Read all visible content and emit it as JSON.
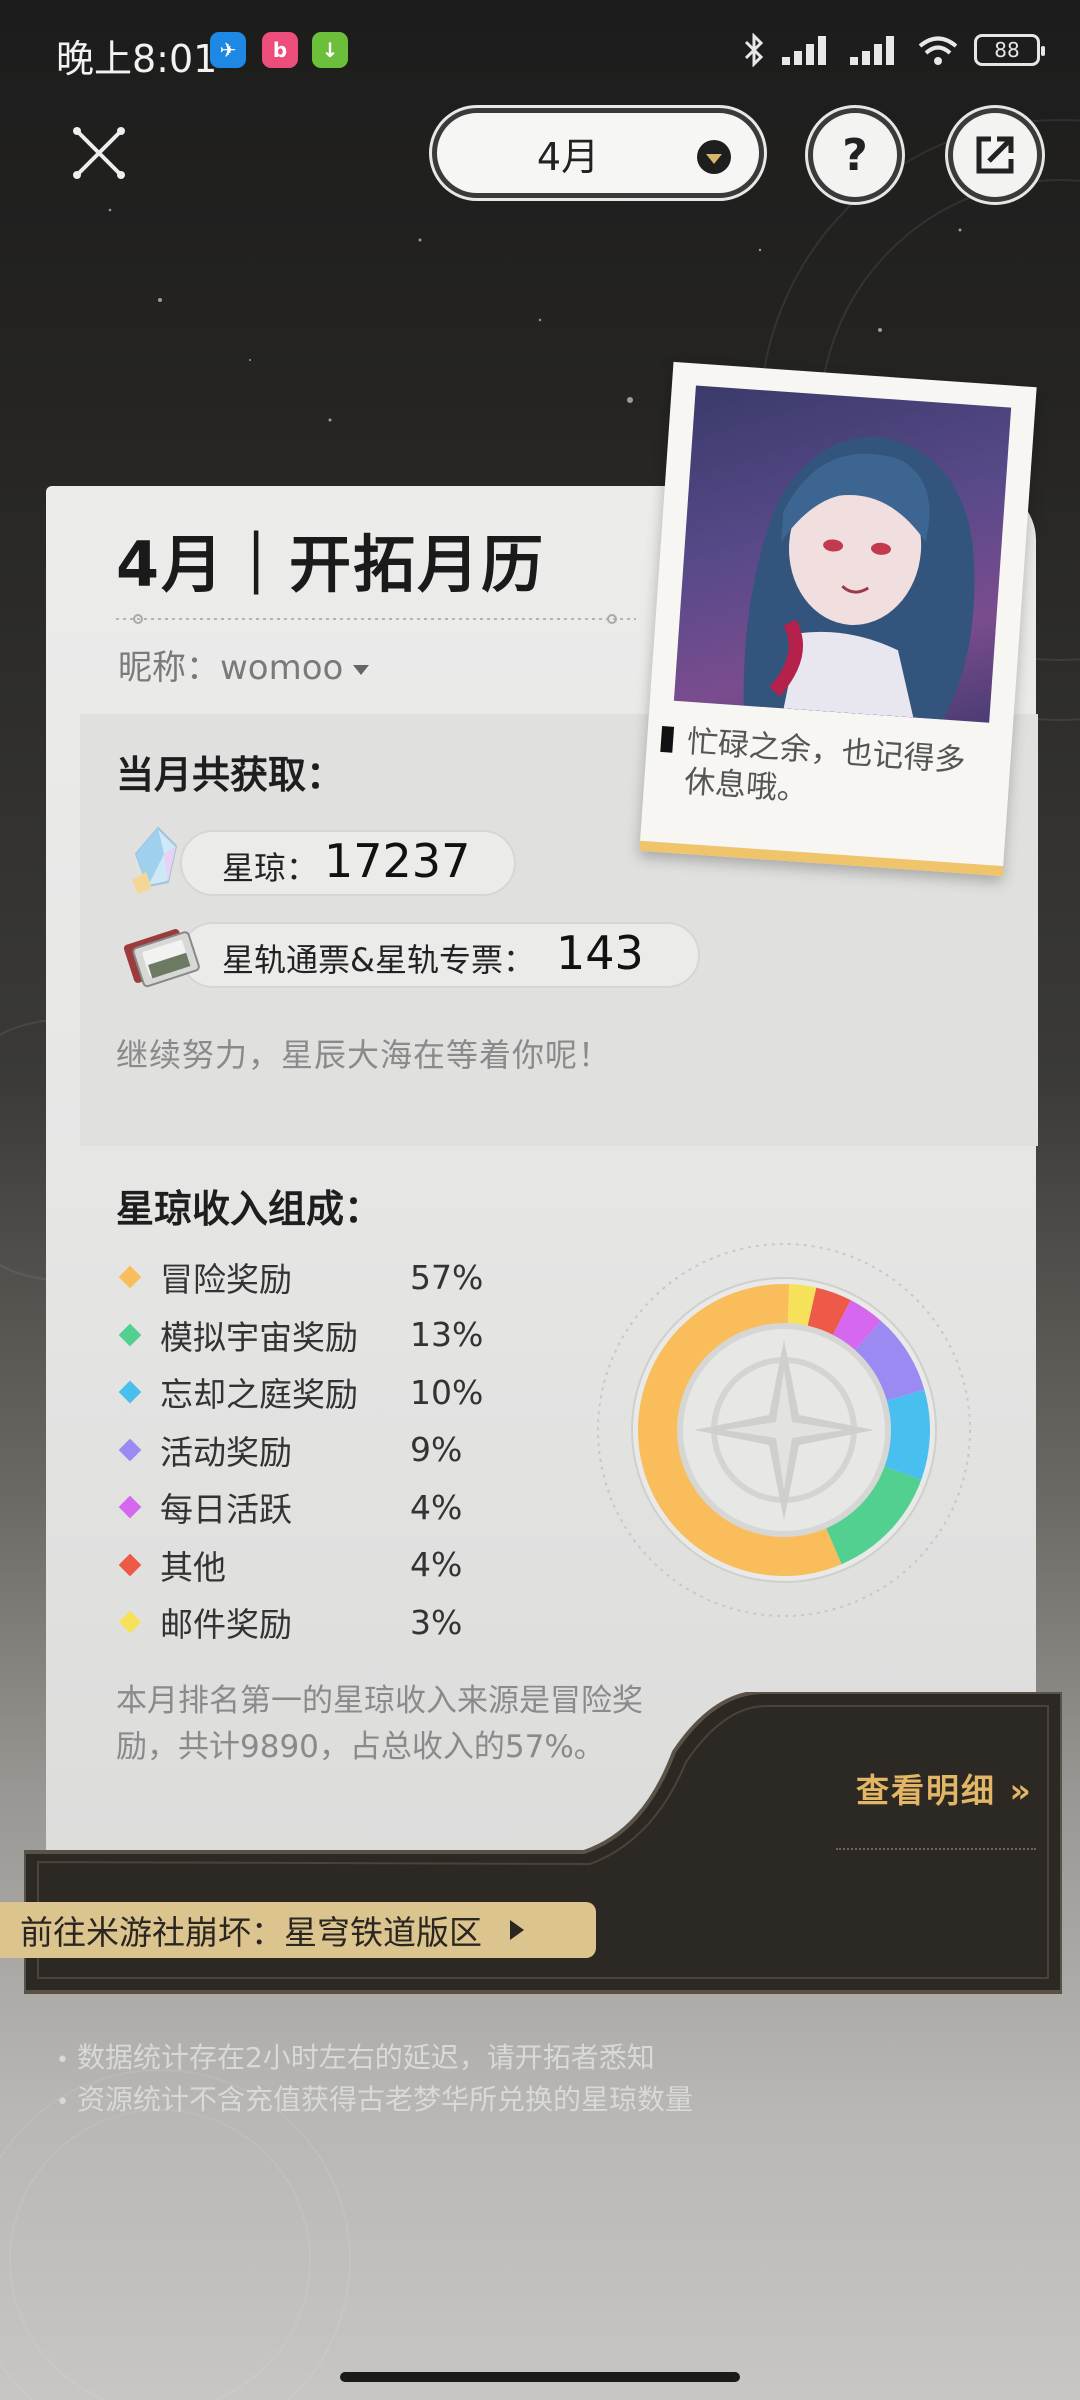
{
  "status_bar": {
    "time": "晚上8:01",
    "battery": "88",
    "apps": [
      {
        "icon": "feather-app-icon",
        "glyph": "✈",
        "color": "#1e88e5"
      },
      {
        "icon": "bilibili-app-icon",
        "glyph": "b",
        "color": "#ec4d7b"
      },
      {
        "icon": "download-app-icon",
        "glyph": "↓",
        "color": "#6bbf3a"
      }
    ]
  },
  "header": {
    "month_selector": "4月",
    "help_label": "?"
  },
  "card": {
    "title": "4月｜开拓月历",
    "nickname_label": "昵称：",
    "nickname": "womoo",
    "photo_caption": "忙碌之余，也记得多休息哦。"
  },
  "summary": {
    "heading": "当月共获取：",
    "resources": [
      {
        "label": "星琼：",
        "value": "17237",
        "icon": "stellar-jade-icon"
      },
      {
        "label": "星轨通票&星轨专票：",
        "value": "143",
        "icon": "star-rail-pass-icon"
      }
    ],
    "encouragement": "继续努力，星辰大海在等着你呢！"
  },
  "income": {
    "heading": "星琼收入组成：",
    "top_source_text": "本月排名第一的星琼收入来源是冒险奖励，共计9890，占总收入的57%。",
    "sources": [
      {
        "name": "冒险奖励",
        "percent": "57%",
        "value": 57,
        "color": "#f9bd5c"
      },
      {
        "name": "模拟宇宙奖励",
        "percent": "13%",
        "value": 13,
        "color": "#52d08f"
      },
      {
        "name": "忘却之庭奖励",
        "percent": "10%",
        "value": 10,
        "color": "#49bff0"
      },
      {
        "name": "活动奖励",
        "percent": "9%",
        "value": 9,
        "color": "#9a8af2"
      },
      {
        "name": "每日活跃",
        "percent": "4%",
        "value": 4,
        "color": "#d667ef"
      },
      {
        "name": "其他",
        "percent": "4%",
        "value": 4,
        "color": "#ee5a48"
      },
      {
        "name": "邮件奖励",
        "percent": "3%",
        "value": 3,
        "color": "#f6e25a"
      }
    ]
  },
  "actions": {
    "view_detail": "查看明细 »",
    "goto_forum": "前往米游社崩坏：星穹铁道版区"
  },
  "footnotes": [
    "数据统计存在2小时左右的延迟，请开拓者悉知",
    "资源统计不含充值获得古老梦华所兑换的星琼数量"
  ]
}
